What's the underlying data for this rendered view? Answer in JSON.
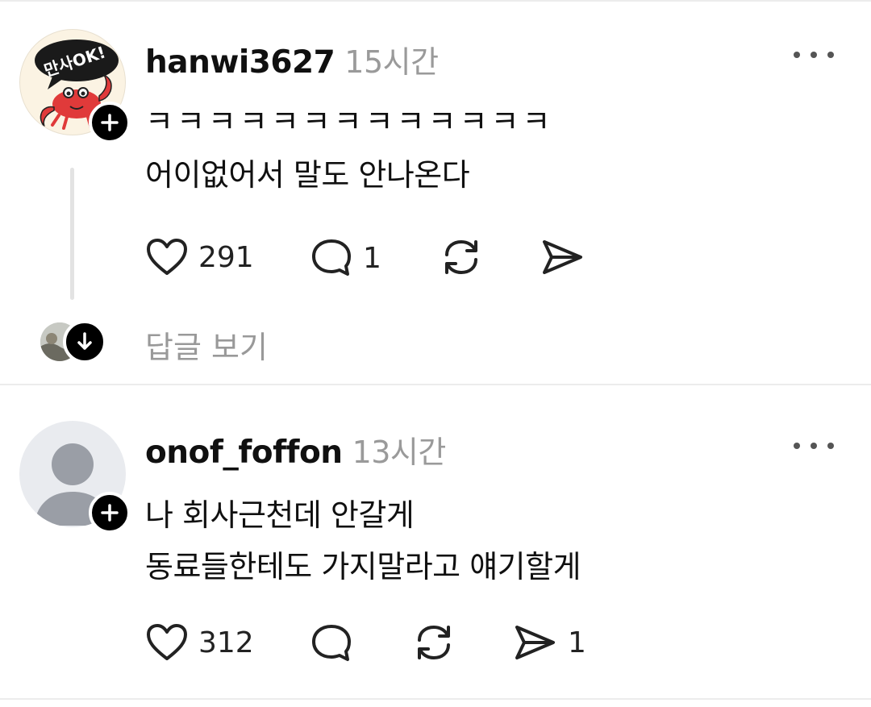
{
  "posts": [
    {
      "username": "hanwi3627",
      "time": "15시간",
      "avatar_text": "만사OK!",
      "lines": [
        "ㅋㅋㅋㅋㅋㅋㅋㅋㅋㅋㅋㅋㅋ",
        "어이없어서 말도 안나온다"
      ],
      "likes": "291",
      "comments": "1",
      "reposts": "",
      "shares": "",
      "view_replies": "답글 보기"
    },
    {
      "username": "onof_foffon",
      "time": "13시간",
      "lines": [
        "나 회사근천데 안갈게",
        "동료들한테도 가지말라고 얘기할게"
      ],
      "likes": "312",
      "comments": "",
      "reposts": "",
      "shares": "1"
    }
  ],
  "icons": {
    "like": "heart-icon",
    "comment": "comment-bubble-icon",
    "repost": "repost-icon",
    "share": "send-icon",
    "more": "more-options-icon",
    "follow": "plus-icon",
    "expand": "arrow-down-icon"
  },
  "colors": {
    "text": "#101010",
    "muted": "#999999",
    "divider": "#ececec",
    "badge": "#000000",
    "crab": "#e03a3a"
  }
}
